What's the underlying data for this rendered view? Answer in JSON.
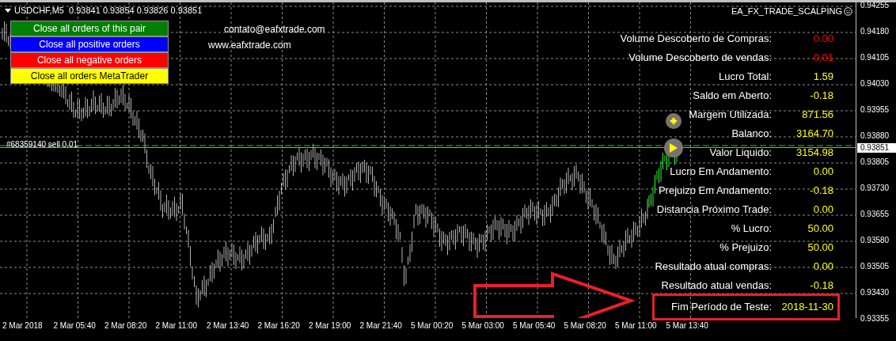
{
  "chart": {
    "symbol_header": "USDCHF,M5  0.93841 0.93854 0.93826 0.93851",
    "expert_name": "EA_FX_TRADE_SCALPING",
    "order_label": "#68359140 sell 0.01",
    "current_price": "0.93851",
    "price_axis": [
      "0.94255",
      "0.94180",
      "0.94105",
      "0.94030",
      "0.93955",
      "0.93880",
      "0.93805",
      "0.93730",
      "0.93655",
      "0.93580",
      "0.93505",
      "0.93430",
      "0.93355"
    ],
    "time_axis": [
      "2 Mar 2018",
      "2 Mar 05:40",
      "2 Mar 08:20",
      "2 Mar 11:00",
      "2 Mar 13:40",
      "2 Mar 16:20",
      "2 Mar 19:00",
      "2 Mar 21:40",
      "5 Mar 00:20",
      "5 Mar 03:00",
      "5 Mar 05:40",
      "5 Mar 08:20",
      "5 Mar 11:00",
      "5 Mar 13:40"
    ]
  },
  "buttons": [
    {
      "label": "Close all orders of this pair",
      "color": "#008000"
    },
    {
      "label": "Close all positive orders",
      "color": "#0000ff"
    },
    {
      "label": "Close all negative orders",
      "color": "#ff0000"
    },
    {
      "label": "Close all orders MetaTrader",
      "color": "#ffff00"
    }
  ],
  "contact": {
    "email": "contato@eafxtrade.com",
    "website": "www.eafxtrade.com"
  },
  "stats": [
    {
      "label": "Volume Descoberto de Compras:",
      "value": "0.00",
      "color": "#ff0000",
      "highlighted": false
    },
    {
      "label": "Volume Descoberto de vendas:",
      "value": "0.01",
      "color": "#ff0000",
      "highlighted": false
    },
    {
      "label": "Lucro Total:",
      "value": "1.59",
      "color": "#ffff00",
      "highlighted": false
    },
    {
      "label": "Saldo em Aberto:",
      "value": "-0.18",
      "color": "#ffff00",
      "highlighted": false
    },
    {
      "label": "Margem Utilizada:",
      "value": "871.56",
      "color": "#ffff00",
      "highlighted": false
    },
    {
      "label": "Balanco:",
      "value": "3164.70",
      "color": "#ffff00",
      "highlighted": false
    },
    {
      "label": "Valor Liquido:",
      "value": "3154.98",
      "color": "#ffff00",
      "highlighted": false
    },
    {
      "label": "Lucro Em Andamento:",
      "value": "0.00",
      "color": "#ffff00",
      "highlighted": false
    },
    {
      "label": "Prejuizo Em Andamento:",
      "value": "-0.18",
      "color": "#ffff00",
      "highlighted": false
    },
    {
      "label": "Distancia Próximo Trade:",
      "value": "0.00",
      "color": "#ffff00",
      "highlighted": false
    },
    {
      "label": "% Lucro:",
      "value": "50.00",
      "color": "#ffff00",
      "highlighted": false
    },
    {
      "label": "% Prejuizo:",
      "value": "50.00",
      "color": "#ffff00",
      "highlighted": false
    },
    {
      "label": "Resultado atual compras:",
      "value": "0.00",
      "color": "#ffff00",
      "highlighted": false
    },
    {
      "label": "Resultado atual vendas:",
      "value": "-0.18",
      "color": "#ffff00",
      "highlighted": false
    },
    {
      "label": "Fim Período de Teste:",
      "value": "2018-11-30",
      "color": "#ffff00",
      "highlighted": true
    }
  ]
}
